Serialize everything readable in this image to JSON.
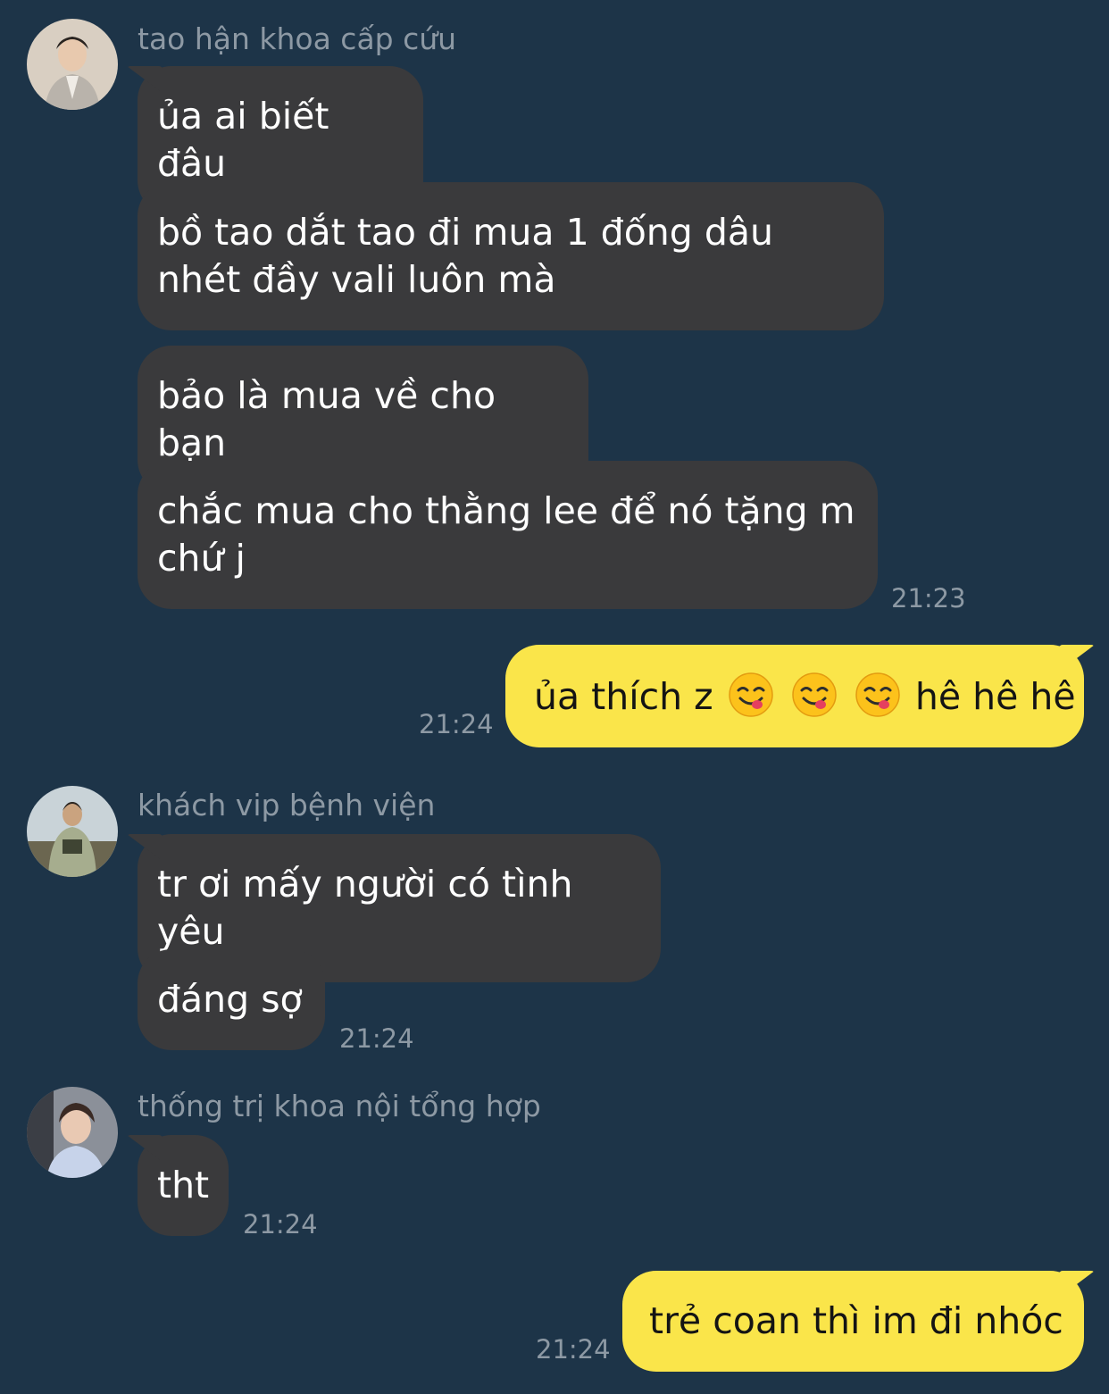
{
  "conversation": {
    "group1": {
      "sender": "tao hận khoa cấp cứu",
      "messages": [
        "ủa ai biết đâu",
        "bồ tao dắt tao đi mua 1 đống dâu nhét đầy vali luôn mà",
        "bảo là mua về cho bạn",
        "chắc mua cho thằng lee để nó tặng m chứ j"
      ],
      "time": "21:23"
    },
    "me1": {
      "text_before": "ủa thích z",
      "emojis": [
        "yum-face-icon",
        "yum-face-icon",
        "yum-face-icon"
      ],
      "text_after": "hê hê hê",
      "time": "21:24"
    },
    "group2": {
      "sender": "khách vip bệnh viện",
      "messages": [
        "tr ơi mấy người có tình yêu",
        "đáng sợ"
      ],
      "time": "21:24"
    },
    "group3": {
      "sender": "thống trị khoa nội tổng hợp",
      "messages": [
        "tht"
      ],
      "time": "21:24"
    },
    "me2": {
      "text": "trẻ coan thì im đi nhóc",
      "time": "21:24"
    }
  },
  "colors": {
    "background": "#1d3448",
    "incoming_bubble": "#3a3a3c",
    "outgoing_bubble": "#fae54a",
    "meta_text": "#8d99a4"
  }
}
